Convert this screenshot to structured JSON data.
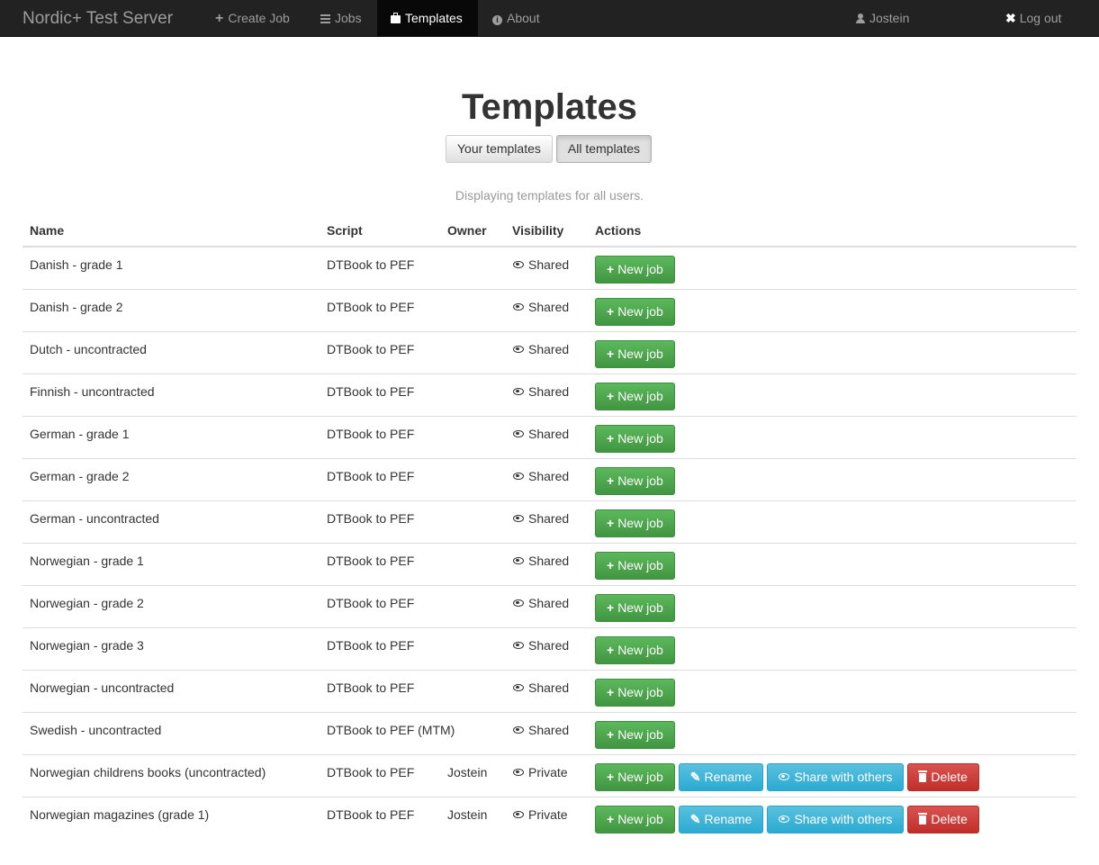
{
  "navbar": {
    "brand": "Nordic+ Test Server",
    "items": [
      {
        "label": "Create Job",
        "icon": "plus-icon"
      },
      {
        "label": "Jobs",
        "icon": "list-icon"
      },
      {
        "label": "Templates",
        "icon": "briefcase-icon",
        "active": true
      },
      {
        "label": "About",
        "icon": "info-icon"
      }
    ],
    "user": "Jostein",
    "logout": "Log out"
  },
  "page": {
    "title": "Templates",
    "toggle": {
      "yours": "Your templates",
      "all": "All templates",
      "active": "all"
    },
    "subtitle": "Displaying templates for all users."
  },
  "table": {
    "headers": {
      "name": "Name",
      "script": "Script",
      "owner": "Owner",
      "visibility": "Visibility",
      "actions": "Actions"
    },
    "rows": [
      {
        "name": "Danish - grade 1",
        "script": "DTBook to PEF",
        "owner": "",
        "visibility": "Shared"
      },
      {
        "name": "Danish - grade 2",
        "script": "DTBook to PEF",
        "owner": "",
        "visibility": "Shared"
      },
      {
        "name": "Dutch - uncontracted",
        "script": "DTBook to PEF",
        "owner": "",
        "visibility": "Shared"
      },
      {
        "name": "Finnish - uncontracted",
        "script": "DTBook to PEF",
        "owner": "",
        "visibility": "Shared"
      },
      {
        "name": "German - grade 1",
        "script": "DTBook to PEF",
        "owner": "",
        "visibility": "Shared"
      },
      {
        "name": "German - grade 2",
        "script": "DTBook to PEF",
        "owner": "",
        "visibility": "Shared"
      },
      {
        "name": "German - uncontracted",
        "script": "DTBook to PEF",
        "owner": "",
        "visibility": "Shared"
      },
      {
        "name": "Norwegian - grade 1",
        "script": "DTBook to PEF",
        "owner": "",
        "visibility": "Shared"
      },
      {
        "name": "Norwegian - grade 2",
        "script": "DTBook to PEF",
        "owner": "",
        "visibility": "Shared"
      },
      {
        "name": "Norwegian - grade 3",
        "script": "DTBook to PEF",
        "owner": "",
        "visibility": "Shared"
      },
      {
        "name": "Norwegian - uncontracted",
        "script": "DTBook to PEF",
        "owner": "",
        "visibility": "Shared"
      },
      {
        "name": "Swedish - uncontracted",
        "script": "DTBook to PEF (MTM)",
        "owner": "",
        "visibility": "Shared"
      },
      {
        "name": "Norwegian childrens books (uncontracted)",
        "script": "DTBook to PEF",
        "owner": "Jostein",
        "visibility": "Private"
      },
      {
        "name": "Norwegian magazines (grade 1)",
        "script": "DTBook to PEF",
        "owner": "Jostein",
        "visibility": "Private"
      }
    ],
    "buttons": {
      "new_job": "New job",
      "rename": "Rename",
      "share": "Share with others",
      "delete": "Delete"
    }
  },
  "colors": {
    "navbar": "#222222",
    "success": "#5cb85c",
    "info": "#5bc0de",
    "danger": "#d9534f"
  }
}
